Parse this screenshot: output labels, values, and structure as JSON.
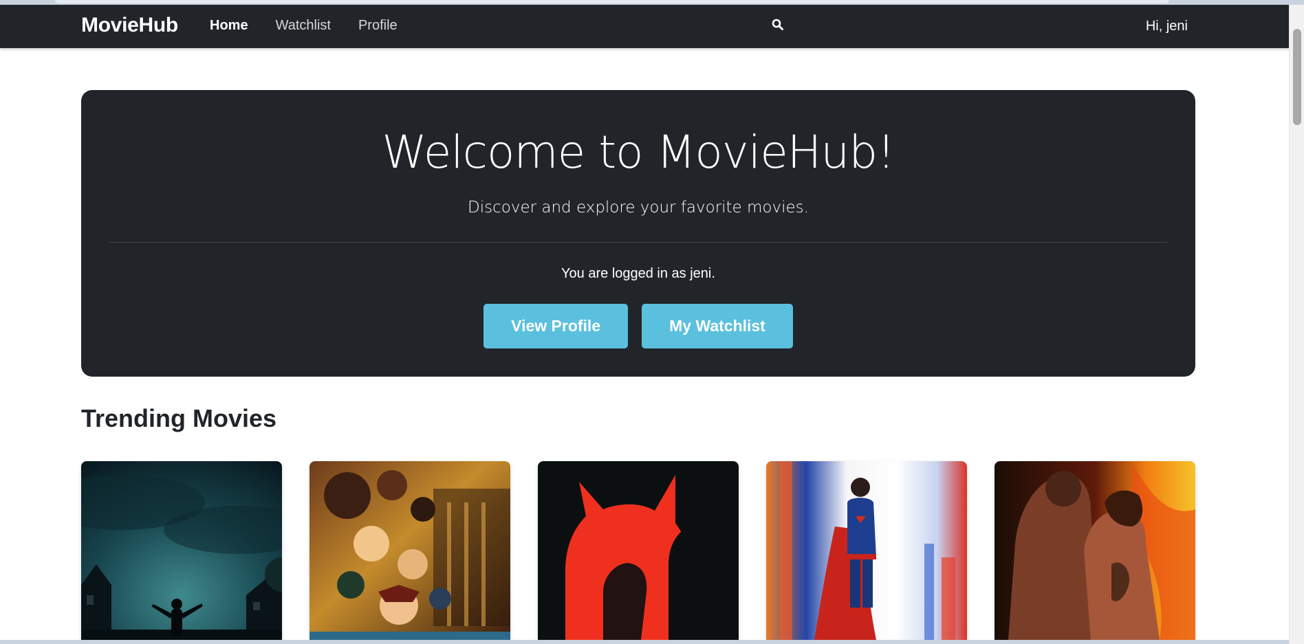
{
  "navbar": {
    "brand": "MovieHub",
    "links": [
      {
        "label": "Home",
        "active": true
      },
      {
        "label": "Watchlist",
        "active": false
      },
      {
        "label": "Profile",
        "active": false
      }
    ],
    "search_icon": "search-icon",
    "greeting": "Hi, jeni"
  },
  "hero": {
    "title": "Welcome to MovieHub!",
    "lead": "Discover and explore your favorite movies.",
    "status": "You are logged in as jeni.",
    "buttons": {
      "view_profile": "View Profile",
      "my_watchlist": "My Watchlist"
    },
    "button_color": "#5bc0de",
    "background_color": "#212529"
  },
  "trending": {
    "title": "Trending Movies",
    "posters": [
      {
        "id": "poster-1",
        "theme": "dark teal night sky, child silhouette with raised arms"
      },
      {
        "id": "poster-2",
        "theme": "anime ensemble, golden and orange tones"
      },
      {
        "id": "poster-3",
        "theme": "red devil-horned silhouette on black"
      },
      {
        "id": "poster-4",
        "theme": "caped superhero, red/blue streaks"
      },
      {
        "id": "poster-5",
        "theme": "embracing couple, fiery orange background"
      }
    ]
  }
}
